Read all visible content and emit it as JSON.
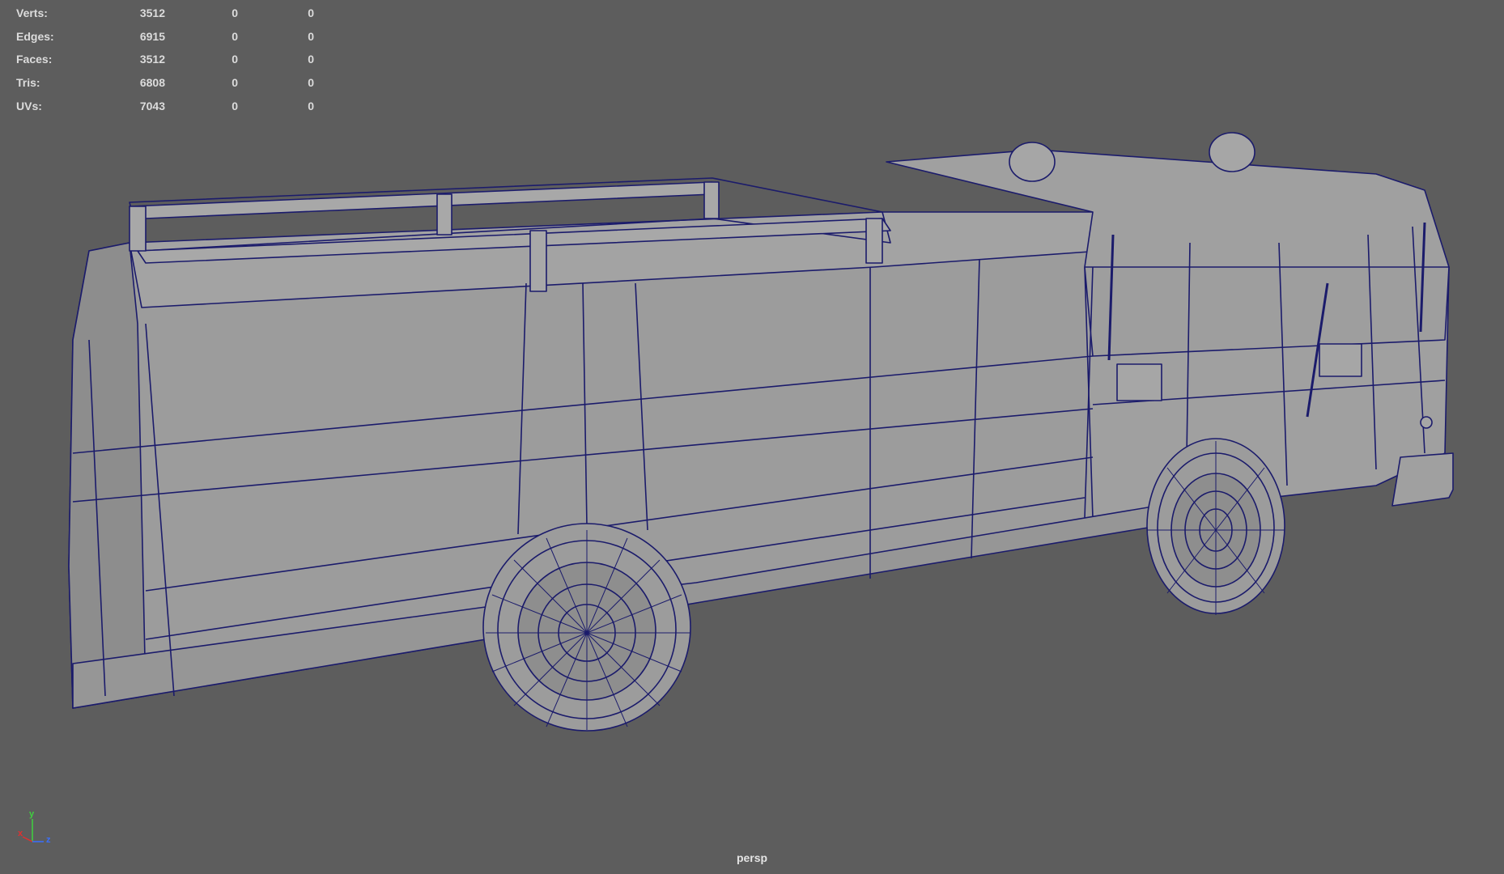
{
  "stats": {
    "rows": [
      {
        "label": "Verts:",
        "value": "3512",
        "a": "0",
        "b": "0"
      },
      {
        "label": "Edges:",
        "value": "6915",
        "a": "0",
        "b": "0"
      },
      {
        "label": "Faces:",
        "value": "3512",
        "a": "0",
        "b": "0"
      },
      {
        "label": "Tris:",
        "value": "6808",
        "a": "0",
        "b": "0"
      },
      {
        "label": "UVs:",
        "value": "7043",
        "a": "0",
        "b": "0"
      }
    ]
  },
  "viewport": {
    "camera": "persp",
    "background_color": "#5d5d5d",
    "wire_color": "#1b1b6b",
    "surface_color": "#9a9a9a"
  },
  "axis_gizmo": {
    "y": "y",
    "x": "x",
    "z": "z",
    "y_color": "#3fd13f",
    "x_color": "#e03030",
    "z_color": "#3a6fff"
  }
}
